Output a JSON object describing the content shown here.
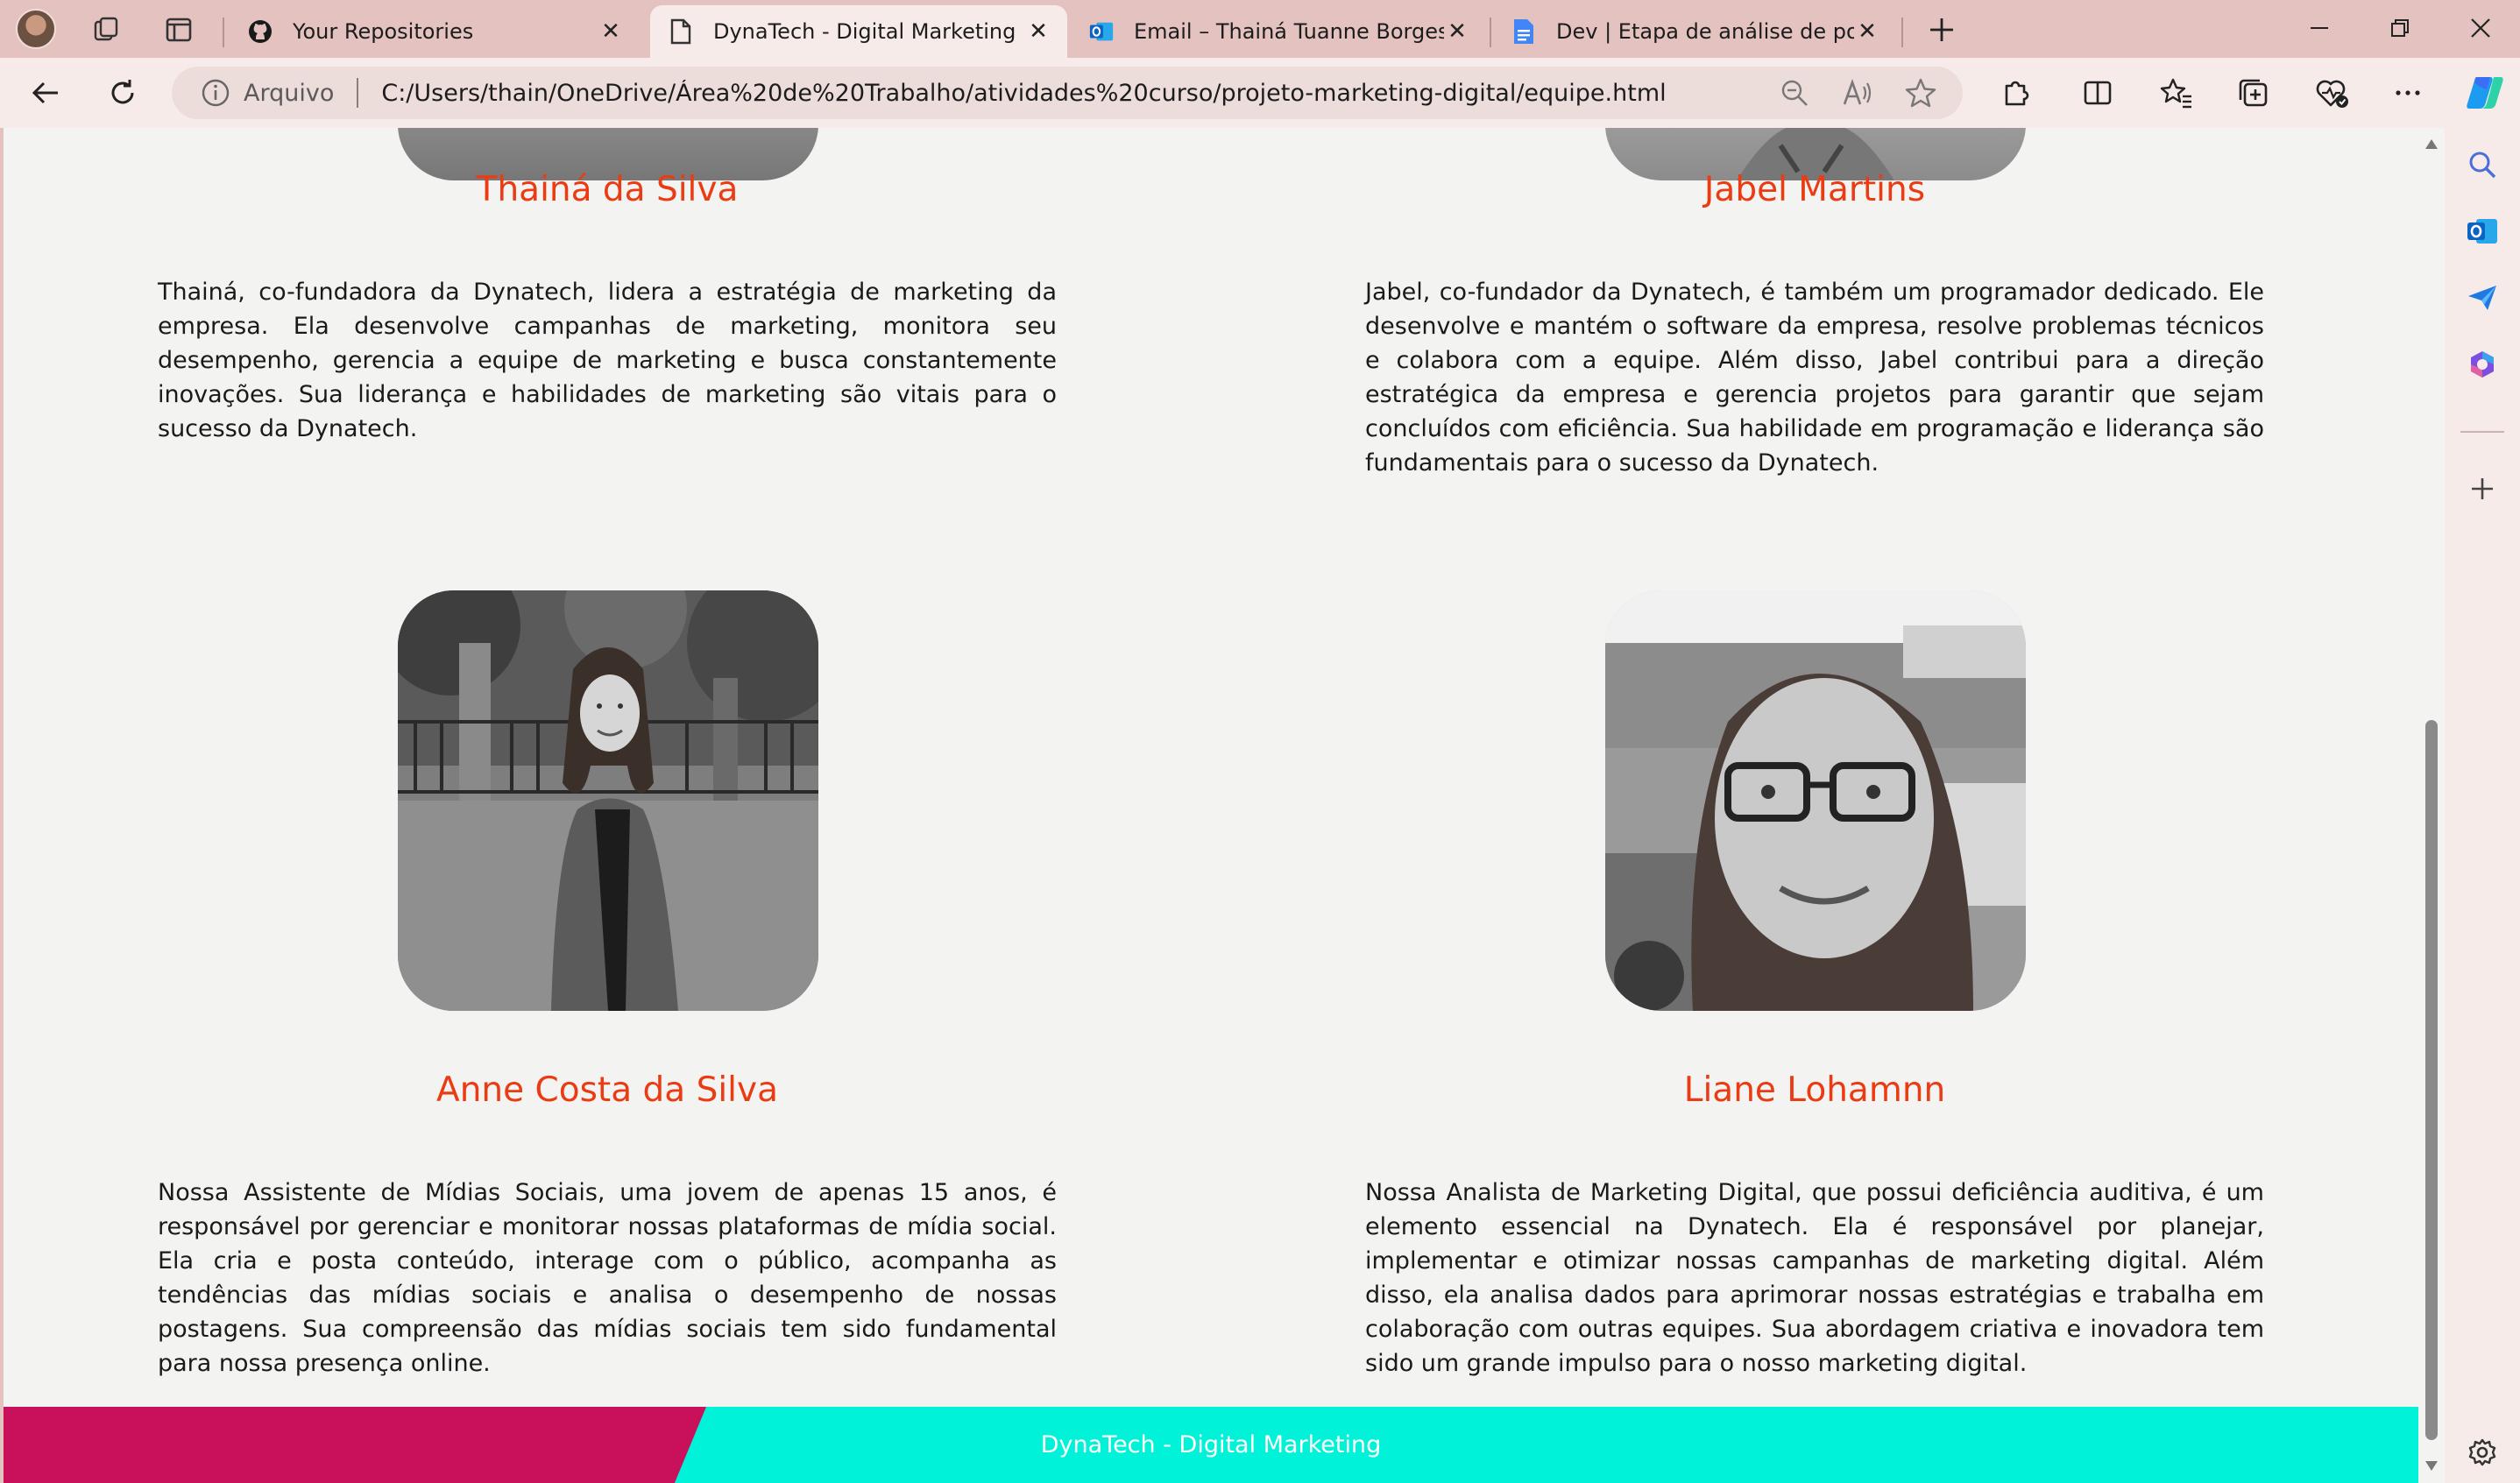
{
  "tabs": [
    {
      "title": "Your Repositories",
      "favicon": "github-icon",
      "active": false
    },
    {
      "title": "DynaTech - Digital Marketing",
      "favicon": "page-icon",
      "active": true
    },
    {
      "title": "Email – Thainá Tuanne Borges Da",
      "favicon": "outlook-icon",
      "active": false
    },
    {
      "title": "Dev | Etapa de análise de portfóli",
      "favicon": "google-docs-icon",
      "active": false
    }
  ],
  "address_bar": {
    "scheme_label": "Arquivo",
    "url": "C:/Users/thain/OneDrive/Área%20de%20Trabalho/atividades%20curso/projeto-marketing-digital/equipe.html"
  },
  "team": [
    {
      "name": "Thainá da Silva",
      "bio": "Thainá, co-fundadora da Dynatech, lidera a estratégia de marketing da empresa. Ela desenvolve campanhas de marketing, monitora seu desempenho, gerencia a equipe de marketing e busca constantemente inovações. Sua liderança e habilidades de marketing são vitais para o sucesso da Dynatech."
    },
    {
      "name": "Jabel Martins",
      "bio": "Jabel, co-fundador da Dynatech, é também um programador dedicado. Ele desenvolve e mantém o software da empresa, resolve problemas técnicos e colabora com a equipe. Além disso, Jabel contribui para a direção estratégica da empresa e gerencia projetos para garantir que sejam concluídos com eficiência. Sua habilidade em programação e liderança são fundamentais para o sucesso da Dynatech."
    },
    {
      "name": "Anne Costa da Silva",
      "bio": "Nossa Assistente de Mídias Sociais, uma jovem de apenas 15 anos, é responsável por gerenciar e monitorar nossas plataformas de mídia social. Ela cria e posta conteúdo, interage com o público, acompanha as tendências das mídias sociais e analisa o desempenho de nossas postagens. Sua compreensão das mídias sociais tem sido fundamental para nossa presença online."
    },
    {
      "name": "Liane Lohamnn",
      "bio": "Nossa Analista de Marketing Digital, que possui deficiência auditiva, é um elemento essencial na Dynatech. Ela é responsável por planejar, implementar e otimizar nossas campanhas de marketing digital. Além disso, ela analisa dados para aprimorar nossas estratégias e trabalha em colaboração com outras equipes. Sua abordagem criativa e inovadora tem sido um grande impulso para o nosso marketing digital."
    }
  ],
  "footer": {
    "text": "DynaTech - Digital Marketing"
  },
  "colors": {
    "name_accent": "#ea3b12",
    "footer_magenta": "#c9105a",
    "footer_cyan": "#00f2d8",
    "chrome_tab_strip": "#e3c2bf"
  }
}
